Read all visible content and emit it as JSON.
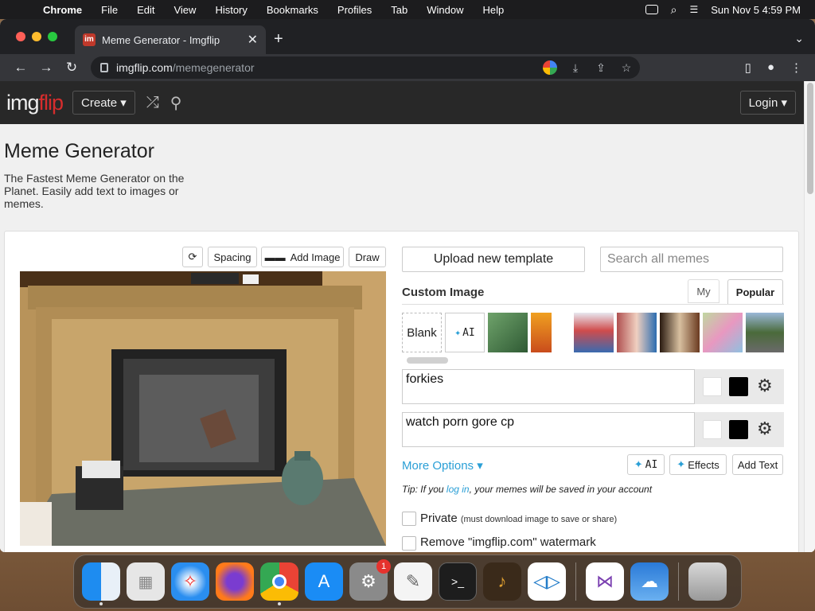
{
  "menubar": {
    "app": "Chrome",
    "items": [
      "File",
      "Edit",
      "View",
      "History",
      "Bookmarks",
      "Profiles",
      "Tab",
      "Window",
      "Help"
    ],
    "clock": "Sun Nov 5  4:59 PM"
  },
  "browser": {
    "tab_title": "Meme Generator - Imgflip",
    "tab_favicon": "im",
    "url_host": "imgflip.com",
    "url_path": "/memegenerator"
  },
  "site": {
    "logo_a": "img",
    "logo_b": "flip",
    "create_label": "Create ▾",
    "login_label": "Login ▾"
  },
  "page": {
    "title": "Meme Generator",
    "description": "The Fastest Meme Generator on the Planet. Easily add text to images or memes."
  },
  "editor": {
    "rotate_icon": "⟳",
    "spacing_label": "Spacing",
    "add_image_label": "Add Image",
    "draw_label": "Draw",
    "upload_label": "Upload new template",
    "search_placeholder": "Search all memes",
    "custom_image_label": "Custom Image",
    "tab_my": "My",
    "tab_popular": "Popular",
    "blank_label": "Blank",
    "ai_label": "AI",
    "text_boxes": [
      {
        "value": "forkies",
        "text_color": "#ffffff",
        "outline_color": "#000000"
      },
      {
        "value": "watch porn gore cp",
        "text_color": "#ffffff",
        "outline_color": "#000000"
      }
    ],
    "more_options_label": "More Options ▾",
    "ai_button_label": "AI",
    "effects_label": "Effects",
    "add_text_label": "Add Text",
    "tip_prefix": "Tip: If you ",
    "tip_link": "log in",
    "tip_suffix": ", your memes will be saved in your account",
    "private_label": "Private",
    "private_note": "(must download image to save or share)",
    "watermark_label": "Remove \"imgflip.com\" watermark"
  },
  "dock": {
    "settings_badge": "1"
  },
  "colors": {
    "accent_link": "#2a9fd6",
    "header_bg": "#282828",
    "logo_red": "#d62d2d"
  }
}
